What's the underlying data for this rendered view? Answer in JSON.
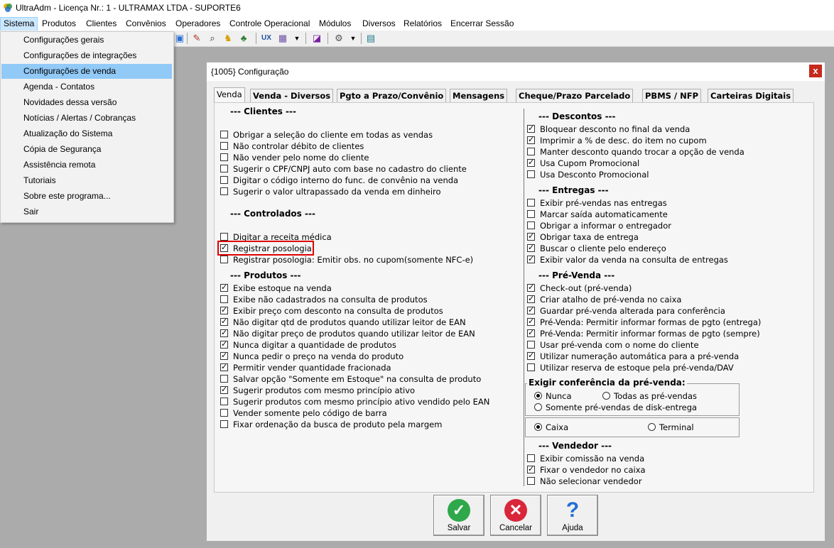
{
  "app": {
    "title": "UltraAdm - Licença Nr.: 1 - ULTRAMAX LTDA  - SUPORTE6"
  },
  "menubar": [
    {
      "label": "Sistema",
      "active": true
    },
    {
      "label": "Produtos"
    },
    {
      "label": "Clientes"
    },
    {
      "label": "Convênios"
    },
    {
      "label": "Operadores"
    },
    {
      "label": "Controle Operacional"
    },
    {
      "label": "Módulos"
    },
    {
      "label": "Diversos"
    },
    {
      "label": "Relatórios"
    },
    {
      "label": "Encerrar Sessão"
    }
  ],
  "sistema_menu": [
    {
      "label": "Configurações gerais"
    },
    {
      "label": "Configurações de integrações"
    },
    {
      "label": "Configurações de venda",
      "highlighted": true
    },
    {
      "label": "Agenda - Contatos"
    },
    {
      "label": "Novidades dessa versão"
    },
    {
      "label": "Notícias / Alertas / Cobranças"
    },
    {
      "label": "Atualização do Sistema"
    },
    {
      "label": "Cópia de Segurança"
    },
    {
      "label": "Assistência remota"
    },
    {
      "label": "Tutoriais"
    },
    {
      "label": "Sobre este programa..."
    },
    {
      "label": "Sair"
    }
  ],
  "dialog": {
    "title": "{1005} Configuração",
    "close": "x",
    "tabs": [
      "Venda",
      "Venda - Diversos",
      "Pgto a Prazo/Convênio",
      "Mensagens",
      "Cheque/Prazo Parcelado",
      "PBMS / NFP",
      "Carteiras Digitais"
    ],
    "left": {
      "clientes": {
        "title": "--- Clientes ---",
        "items": [
          {
            "label": "Obrigar a seleção do cliente em todas as vendas",
            "checked": false
          },
          {
            "label": "Não controlar débito de clientes",
            "checked": false
          },
          {
            "label": "Não vender pelo nome do cliente",
            "checked": false
          },
          {
            "label": "Sugerir o CPF/CNPJ auto com base no cadastro do cliente",
            "checked": false
          },
          {
            "label": "Digitar o código interno do func. de convênio na venda",
            "checked": false
          },
          {
            "label": "Sugerir o valor ultrapassado da venda em dinheiro",
            "checked": false
          }
        ]
      },
      "controlados": {
        "title": "--- Controlados ---",
        "items": [
          {
            "label": "Digitar a receita médica",
            "checked": false
          },
          {
            "label": "Registrar posologia",
            "checked": true
          },
          {
            "label": "Registrar posologia: Emitir obs. no cupom(somente NFC-e)",
            "checked": false
          }
        ]
      },
      "produtos": {
        "title": "--- Produtos ---",
        "items": [
          {
            "label": "Exibe estoque na venda",
            "checked": true
          },
          {
            "label": "Exibe não cadastrados na consulta de produtos",
            "checked": false
          },
          {
            "label": "Exibir preço com desconto na consulta de produtos",
            "checked": true
          },
          {
            "label": "Não digitar qtd de produtos quando utilizar leitor de EAN",
            "checked": true
          },
          {
            "label": "Não digitar preço de produtos quando utilizar leitor de EAN",
            "checked": true
          },
          {
            "label": "Nunca digitar a quantidade de produtos",
            "checked": true
          },
          {
            "label": "Nunca pedir o preço na venda do produto",
            "checked": true
          },
          {
            "label": "Permitir vender quantidade fracionada",
            "checked": true
          },
          {
            "label": "Salvar opção \"Somente em Estoque\" na consulta de produto",
            "checked": false
          },
          {
            "label": "Sugerir produtos com mesmo princípio ativo",
            "checked": true
          },
          {
            "label": "Sugerir produtos com mesmo princípio ativo vendido pelo EAN",
            "checked": false
          },
          {
            "label": "Vender somente pelo código de barra",
            "checked": false
          },
          {
            "label": "Fixar ordenação da busca de produto pela margem",
            "checked": false
          }
        ]
      }
    },
    "right": {
      "descontos": {
        "title": "--- Descontos ---",
        "items": [
          {
            "label": "Bloquear desconto no final da venda",
            "checked": true
          },
          {
            "label": "Imprimir a % de desc. do item no cupom",
            "checked": true
          },
          {
            "label": "Manter desconto quando trocar a opção de venda",
            "checked": false
          },
          {
            "label": "Usa Cupom Promocional",
            "checked": true
          },
          {
            "label": "Usa Desconto Promocional",
            "checked": false
          }
        ]
      },
      "entregas": {
        "title": "--- Entregas ---",
        "items": [
          {
            "label": "Exibir pré-vendas nas entregas",
            "checked": false
          },
          {
            "label": "Marcar saída automaticamente",
            "checked": false
          },
          {
            "label": "Obrigar a informar o entregador",
            "checked": false
          },
          {
            "label": "Obrigar taxa de entrega",
            "checked": true
          },
          {
            "label": "Buscar o cliente pelo endereço",
            "checked": true
          },
          {
            "label": "Exibir valor da venda na consulta de entregas",
            "checked": true
          }
        ]
      },
      "prevenda": {
        "title": "--- Pré-Venda ---",
        "items": [
          {
            "label": "Check-out (pré-venda)",
            "checked": true
          },
          {
            "label": "Criar atalho de pré-venda no caixa",
            "checked": true
          },
          {
            "label": "Guardar pré-venda alterada para conferência",
            "checked": true
          },
          {
            "label": "Pré-Venda: Permitir informar formas de pgto (entrega)",
            "checked": true
          },
          {
            "label": "Pré-Venda: Permitir informar formas de pgto (sempre)",
            "checked": true
          },
          {
            "label": "Usar pré-venda com o nome do cliente",
            "checked": false
          },
          {
            "label": "Utilizar numeração automática para a pré-venda",
            "checked": true
          },
          {
            "label": "Utilizar reserva de estoque pela pré-venda/DAV",
            "checked": false
          }
        ]
      },
      "conferencia": {
        "title": "Exigir conferência da pré-venda:",
        "options": [
          "Nunca",
          "Todas as pré-vendas",
          "Somente pré-vendas de disk-entrega"
        ],
        "selected": "Nunca"
      },
      "local": {
        "options": [
          "Caixa",
          "Terminal"
        ],
        "selected": "Caixa"
      },
      "vendedor": {
        "title": "--- Vendedor ---",
        "items": [
          {
            "label": "Exibir comissão na venda",
            "checked": false
          },
          {
            "label": "Fixar o vendedor no caixa",
            "checked": true
          },
          {
            "label": "Não selecionar vendedor",
            "checked": false
          }
        ]
      }
    },
    "buttons": {
      "save": "Salvar",
      "cancel": "Cancelar",
      "help": "Ajuda"
    }
  },
  "colors": {
    "menu_highlight": "#91c9f7",
    "highlight_frame": "#e00000",
    "save": "#2ea84a",
    "cancel": "#d9263a",
    "help": "#1f6fd6"
  }
}
